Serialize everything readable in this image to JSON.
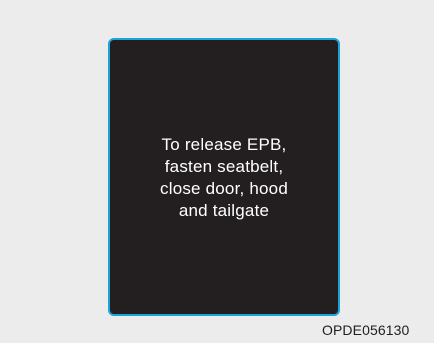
{
  "display": {
    "message_lines": [
      "To release EPB,",
      "fasten seatbelt,",
      "close door, hood",
      "and tailgate"
    ],
    "background_color": "#231f20",
    "border_color": "#1aa3d8",
    "text_color": "#ffffff"
  },
  "figure": {
    "code": "OPDE056130"
  },
  "page": {
    "background_color": "#ececed"
  }
}
